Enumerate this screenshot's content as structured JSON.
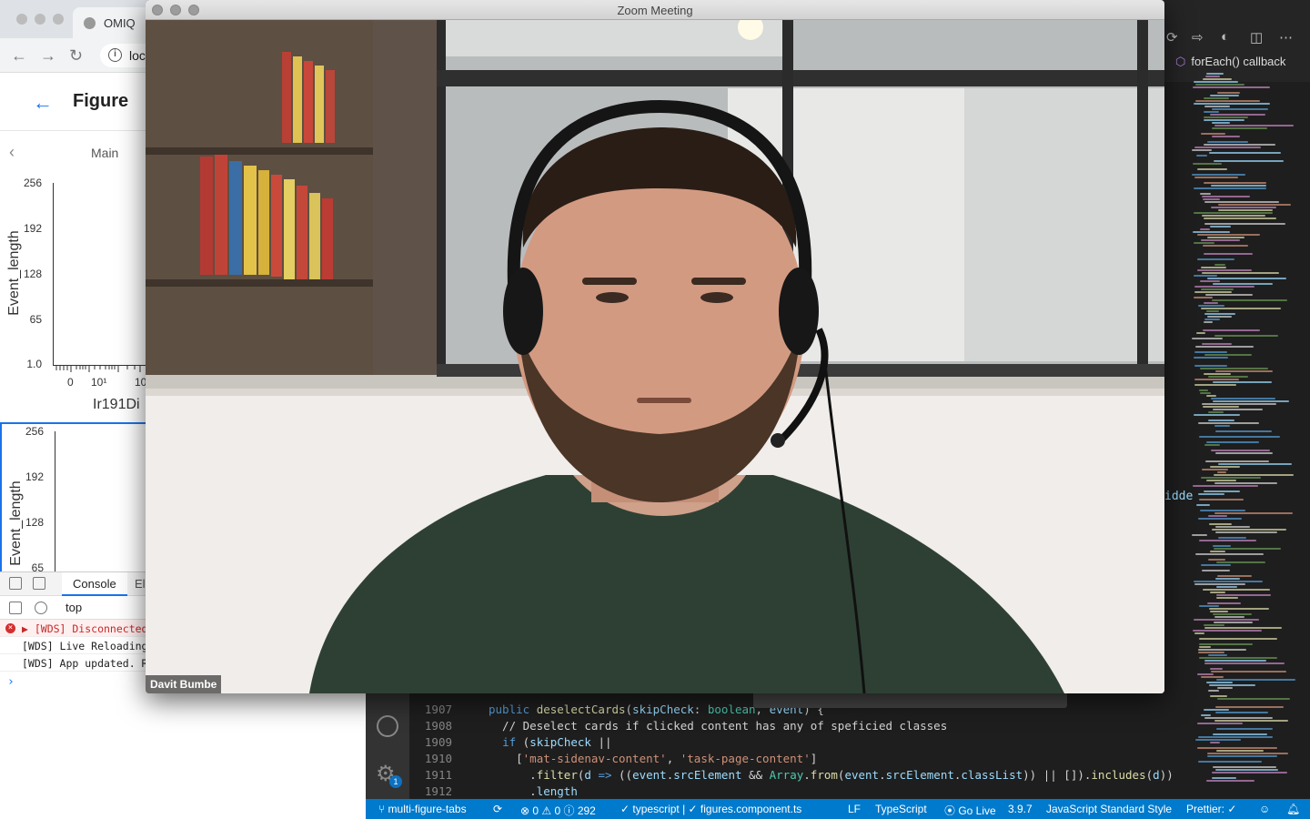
{
  "browser": {
    "tab_title": "OMIQ",
    "url": "loc",
    "page_title": "Figure",
    "tab_label": "Main",
    "plot1": {
      "ylabel": "Event_length",
      "yticks": [
        "256",
        "192",
        "128",
        "65",
        "1.0"
      ],
      "xticks": [
        "0",
        "10¹",
        "10"
      ],
      "xlabel": "Ir191Di"
    },
    "plot2": {
      "ylabel": "Event_length",
      "yticks": [
        "256",
        "192",
        "128",
        "65"
      ]
    },
    "devtools": {
      "console_tab": "Console",
      "elements_tab": "El",
      "context": "top",
      "logs": [
        {
          "level": "error",
          "text": "▶ [WDS] Disconnected!"
        },
        {
          "level": "info",
          "text": "[WDS] Live Reloading"
        },
        {
          "level": "info",
          "text": "[WDS] App updated. R"
        }
      ],
      "prompt": "›"
    }
  },
  "zoom": {
    "window_title": "Zoom Meeting",
    "participant_name": "Davit Bumbe"
  },
  "vscode": {
    "breadcrumb": "forEach() callback",
    "peek_text": "idde",
    "code_lines": [
      {
        "num": "1907",
        "code": "public deselectCards(skipCheck: boolean, event) {"
      },
      {
        "num": "1908",
        "code": "  // Deselect cards if clicked content has any of speficied classes"
      },
      {
        "num": "1909",
        "code": "  if (skipCheck ||"
      },
      {
        "num": "1910",
        "code": "    ['mat-sidenav-content', 'task-page-content']"
      },
      {
        "num": "1911",
        "code": "      .filter(d => ((event.srcElement && Array.from(event.srcElement.classList)) || []).includes(d))"
      },
      {
        "num": "1912",
        "code": "      .length"
      }
    ],
    "settings_badge": "1",
    "status": {
      "branch": "multi-figure-tabs",
      "problems": "⊗ 0 ⚠ 0 ⓘ 292",
      "ts_check": "✓ typescript | ✓ figures.component.ts",
      "eol": "LF",
      "language": "TypeScript",
      "go_live": "Go Live",
      "version": "3.9.7",
      "linter": "JavaScript Standard Style",
      "prettier": "Prettier: ✓"
    }
  }
}
